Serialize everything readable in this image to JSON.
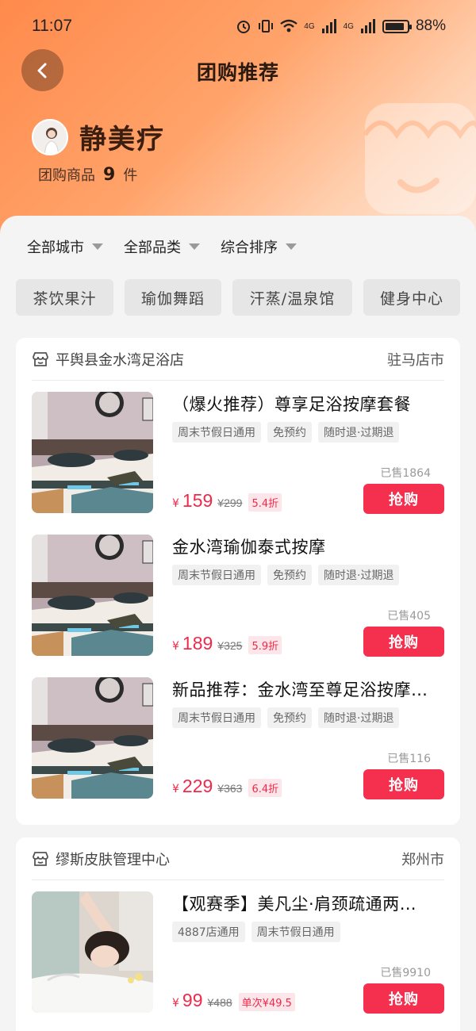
{
  "status_bar": {
    "time": "11:07",
    "network_a": "4G",
    "network_b": "4G",
    "battery_percent": "88%",
    "battery_level": 0.88
  },
  "nav": {
    "title": "团购推荐"
  },
  "shop": {
    "name": "静美疗",
    "count_label": "团购商品",
    "count": "9",
    "count_unit": "件"
  },
  "filters": [
    {
      "label": "全部城市"
    },
    {
      "label": "全部品类"
    },
    {
      "label": "综合排序"
    }
  ],
  "categories": [
    {
      "label": "茶饮果汁"
    },
    {
      "label": "瑜伽舞蹈"
    },
    {
      "label": "汗蒸/温泉馆"
    },
    {
      "label": "健身中心"
    }
  ],
  "stores": [
    {
      "name": "平舆县金水湾足浴店",
      "city": "驻马店市",
      "items": [
        {
          "title": "（爆火推荐）尊享足浴按摩套餐",
          "tags": [
            "周末节假日通用",
            "免预约",
            "随时退·过期退"
          ],
          "sold": "已售1864",
          "yen": "¥",
          "price": "159",
          "original": "¥299",
          "discount": "5.4折",
          "buy": "抢购"
        },
        {
          "title": "金水湾瑜伽泰式按摩",
          "tags": [
            "周末节假日通用",
            "免预约",
            "随时退·过期退"
          ],
          "sold": "已售405",
          "yen": "¥",
          "price": "189",
          "original": "¥325",
          "discount": "5.9折",
          "buy": "抢购"
        },
        {
          "title": "新品推荐：金水湾至尊足浴按摩…",
          "tags": [
            "周末节假日通用",
            "免预约",
            "随时退·过期退"
          ],
          "sold": "已售116",
          "yen": "¥",
          "price": "229",
          "original": "¥363",
          "discount": "6.4折",
          "buy": "抢购"
        }
      ]
    },
    {
      "name": "缪斯皮肤管理中心",
      "city": "郑州市",
      "items": [
        {
          "title": "【观赛季】美凡尘·肩颈疏通两…",
          "tags": [
            "4887店通用",
            "周末节假日通用"
          ],
          "sold": "已售9910",
          "yen": "¥",
          "price": "99",
          "original": "¥488",
          "discount": "单次¥49.5",
          "buy": "抢购"
        }
      ]
    }
  ],
  "colors": {
    "accent": "#f5304e",
    "header_orange": "#ff8a4c",
    "price": "#f0294a"
  },
  "icons": {
    "back": "chevron-left-icon",
    "store": "store-icon"
  }
}
